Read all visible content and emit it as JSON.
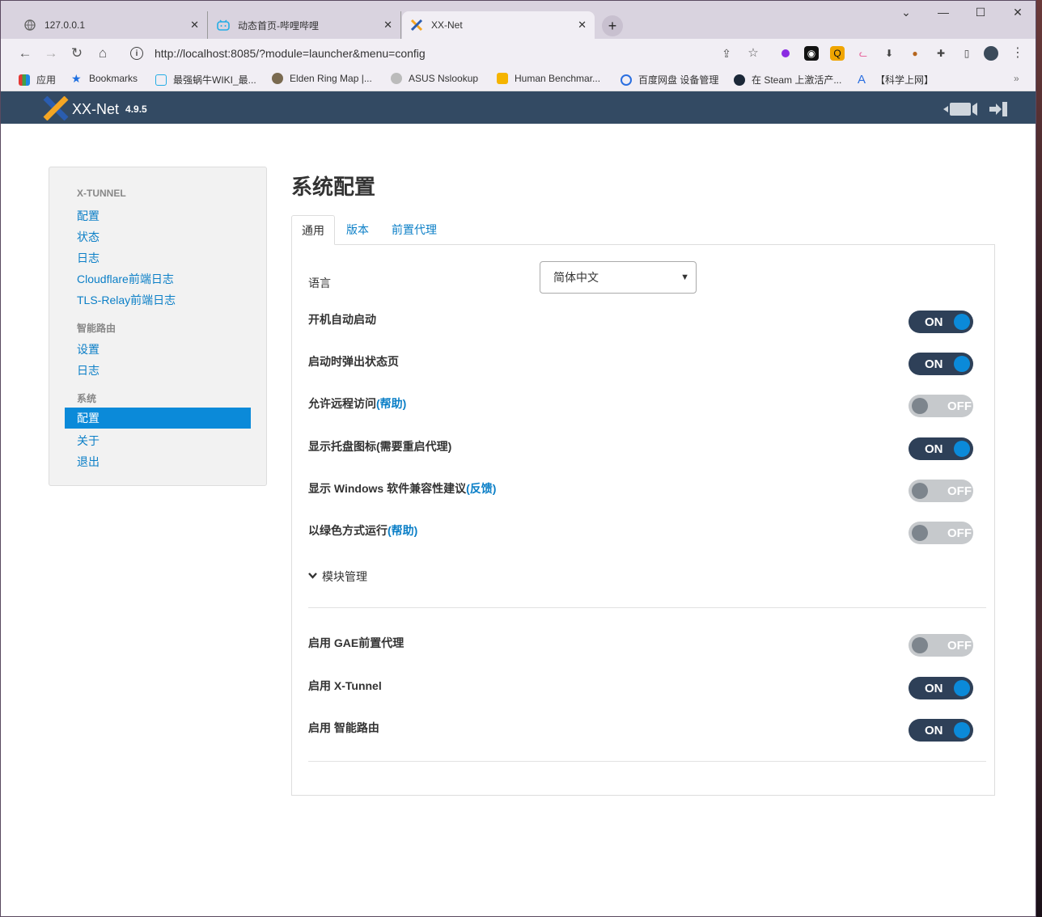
{
  "browser": {
    "tabs": [
      {
        "title": "127.0.0.1"
      },
      {
        "title": "动态首页-哔哩哔哩"
      },
      {
        "title": "XX-Net"
      }
    ],
    "new_tab": "+",
    "url": "http://localhost:8085/?module=launcher&menu=config",
    "window_controls": {
      "minimize": "⌄",
      "min": "—",
      "max": "☐",
      "close": "✕"
    },
    "bookmarks": [
      {
        "label": "应用"
      },
      {
        "label": "Bookmarks"
      },
      {
        "label": "最强蜗牛WIKI_最..."
      },
      {
        "label": "Elden Ring Map |..."
      },
      {
        "label": "ASUS Nslookup"
      },
      {
        "label": "Human Benchmar..."
      },
      {
        "label": "百度网盘 设备管理"
      },
      {
        "label": "在 Steam 上激活产..."
      },
      {
        "label": "【科学上网】"
      }
    ],
    "bookmarks_more": "»"
  },
  "app": {
    "name": "XX-Net",
    "version": "4.9.5"
  },
  "sidebar": {
    "sections": [
      {
        "heading": "X-TUNNEL",
        "items": [
          "配置",
          "状态",
          "日志",
          "Cloudflare前端日志",
          "TLS-Relay前端日志"
        ]
      },
      {
        "heading": "智能路由",
        "items": [
          "设置",
          "日志"
        ]
      },
      {
        "heading": "系统",
        "items": [
          "配置",
          "关于",
          "退出"
        ]
      }
    ],
    "active": "配置"
  },
  "main": {
    "title": "系统配置",
    "tabs": [
      "通用",
      "版本",
      "前置代理"
    ],
    "language_label": "语言",
    "language_value": "简体中文",
    "settings": [
      {
        "label": "开机自动启动",
        "help": "",
        "state": "ON"
      },
      {
        "label": "启动时弹出状态页",
        "help": "",
        "state": "ON"
      },
      {
        "label": "允许远程访问",
        "help": "(帮助)",
        "state": "OFF"
      },
      {
        "label": "显示托盘图标(需要重启代理)",
        "help": "",
        "state": "ON"
      },
      {
        "label": "显示 Windows 软件兼容性建议",
        "help": "(反馈)",
        "state": "OFF"
      },
      {
        "label": "以绿色方式运行",
        "help": "(帮助)",
        "state": "OFF"
      }
    ],
    "module_manage": "模块管理",
    "modules": [
      {
        "label": "启用 GAE前置代理",
        "state": "OFF"
      },
      {
        "label": "启用 X-Tunnel",
        "state": "ON"
      },
      {
        "label": "启用 智能路由",
        "state": "ON"
      }
    ]
  }
}
